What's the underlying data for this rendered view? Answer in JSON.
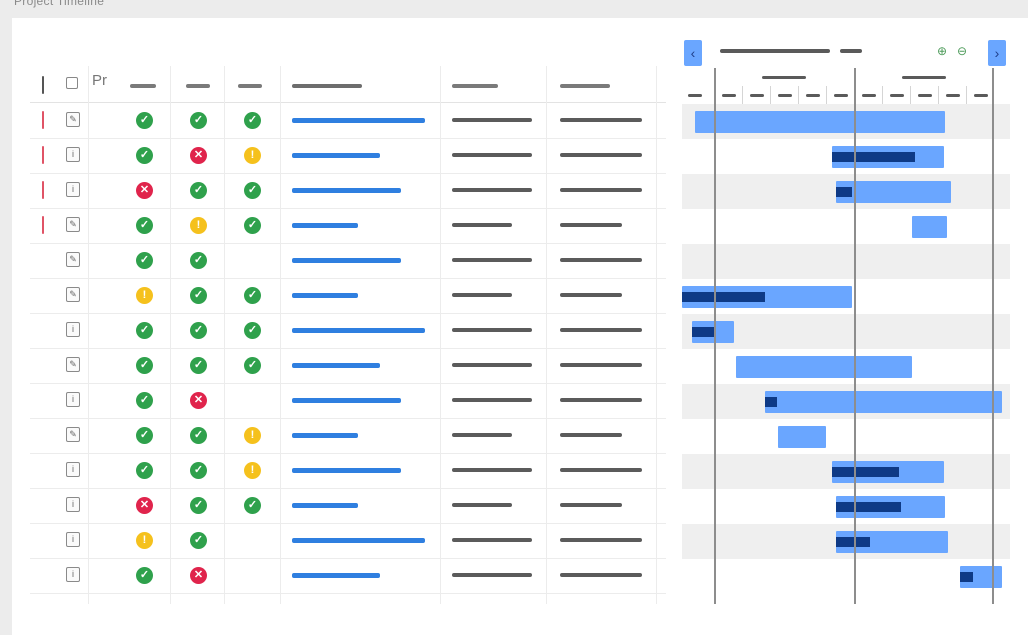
{
  "window": {
    "title": "Project Timeline"
  },
  "grid": {
    "header": {
      "pr_label": "Pr"
    },
    "rows": [
      {
        "marked": true,
        "task_type": "edit",
        "s": [
          "ok",
          "ok",
          "ok"
        ],
        "progress": 0.95
      },
      {
        "marked": true,
        "task_type": "info",
        "s": [
          "ok",
          "err",
          "warn"
        ],
        "progress": 0.63
      },
      {
        "marked": true,
        "task_type": "info",
        "s": [
          "err",
          "ok",
          "ok"
        ],
        "progress": 0.78
      },
      {
        "marked": true,
        "task_type": "edit",
        "s": [
          "ok",
          "warn",
          "ok"
        ],
        "progress": 0.47
      },
      {
        "marked": false,
        "task_type": "edit",
        "s": [
          "ok",
          "ok",
          ""
        ],
        "progress": 0.78
      },
      {
        "marked": false,
        "task_type": "edit",
        "s": [
          "warn",
          "ok",
          "ok"
        ],
        "progress": 0.47
      },
      {
        "marked": false,
        "task_type": "info",
        "s": [
          "ok",
          "ok",
          "ok"
        ],
        "progress": 0.95
      },
      {
        "marked": false,
        "task_type": "edit",
        "s": [
          "ok",
          "ok",
          "ok"
        ],
        "progress": 0.63
      },
      {
        "marked": false,
        "task_type": "info",
        "s": [
          "ok",
          "err",
          ""
        ],
        "progress": 0.78
      },
      {
        "marked": false,
        "task_type": "edit",
        "s": [
          "ok",
          "ok",
          "warn"
        ],
        "progress": 0.47
      },
      {
        "marked": false,
        "task_type": "info",
        "s": [
          "ok",
          "ok",
          "warn"
        ],
        "progress": 0.78
      },
      {
        "marked": false,
        "task_type": "info",
        "s": [
          "err",
          "ok",
          "ok"
        ],
        "progress": 0.47
      },
      {
        "marked": false,
        "task_type": "info",
        "s": [
          "warn",
          "ok",
          ""
        ],
        "progress": 0.95
      },
      {
        "marked": false,
        "task_type": "info",
        "s": [
          "ok",
          "err",
          ""
        ],
        "progress": 0.63
      }
    ]
  },
  "gantt": {
    "nav": {
      "prev_icon": "chevron-left",
      "next_icon": "chevron-right",
      "zoom_in_icon": "zoom-in",
      "zoom_out_icon": "zoom-out"
    },
    "tasks": [
      {
        "start": 0.04,
        "end": 0.82,
        "done": 0.0
      },
      {
        "start": 0.47,
        "end": 0.82,
        "done": 0.74
      },
      {
        "start": 0.48,
        "end": 0.84,
        "done": 0.14
      },
      {
        "start": 0.72,
        "end": 0.83,
        "done": 0.0
      },
      {
        "start": 0.0,
        "end": 0.0,
        "done": 0.0
      },
      {
        "start": 0.0,
        "end": 0.53,
        "done": 0.49
      },
      {
        "start": 0.03,
        "end": 0.16,
        "done": 0.56
      },
      {
        "start": 0.17,
        "end": 0.72,
        "done": 0.0
      },
      {
        "start": 0.26,
        "end": 1.0,
        "done": 0.05
      },
      {
        "start": 0.3,
        "end": 0.45,
        "done": 0.0
      },
      {
        "start": 0.47,
        "end": 0.82,
        "done": 0.6
      },
      {
        "start": 0.48,
        "end": 0.82,
        "done": 0.6
      },
      {
        "start": 0.48,
        "end": 0.83,
        "done": 0.3
      },
      {
        "start": 0.87,
        "end": 1.0,
        "done": 0.3
      }
    ]
  },
  "colors": {
    "ok": "#2fa14c",
    "err": "#e0244c",
    "warn": "#f5c11d",
    "bar": "#6aa6ff",
    "progress_dark": "#0e3a86",
    "progress_blue": "#2f7fe0"
  }
}
